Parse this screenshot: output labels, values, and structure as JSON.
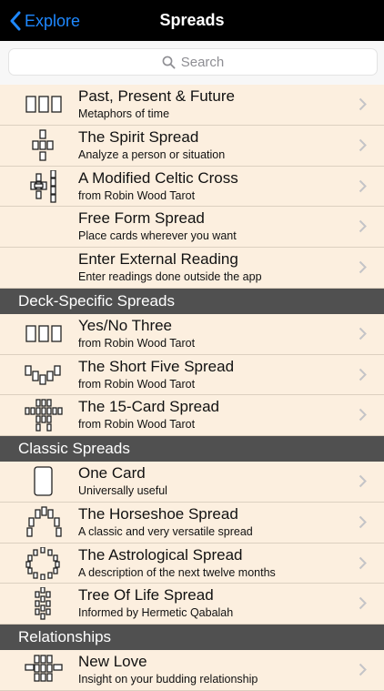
{
  "navbar": {
    "back_label": "Explore",
    "title": "Spreads"
  },
  "search": {
    "placeholder": "Search"
  },
  "section_top": [
    {
      "title": "Past, Present & Future",
      "subtitle": "Metaphors of time",
      "icon": "three-cards-icon"
    },
    {
      "title": "The Spirit Spread",
      "subtitle": "Analyze a person or situation",
      "icon": "spirit-spread-icon"
    },
    {
      "title": "A Modified Celtic Cross",
      "subtitle": "from Robin Wood Tarot",
      "icon": "celtic-cross-icon"
    },
    {
      "title": "Free Form Spread",
      "subtitle": "Place cards wherever you want",
      "icon": ""
    },
    {
      "title": "Enter External Reading",
      "subtitle": "Enter readings done outside the app",
      "icon": ""
    }
  ],
  "section_deck": {
    "header": "Deck-Specific Spreads",
    "items": [
      {
        "title": "Yes/No Three",
        "subtitle": "from Robin Wood Tarot",
        "icon": "three-cards-icon"
      },
      {
        "title": "The Short Five Spread",
        "subtitle": "from Robin Wood Tarot",
        "icon": "five-cards-icon"
      },
      {
        "title": "The 15-Card Spread",
        "subtitle": "from Robin Wood Tarot",
        "icon": "fifteen-cards-icon"
      }
    ]
  },
  "section_classic": {
    "header": "Classic Spreads",
    "items": [
      {
        "title": "One Card",
        "subtitle": "Universally useful",
        "icon": "one-card-icon"
      },
      {
        "title": "The Horseshoe Spread",
        "subtitle": "A classic and very versatile spread",
        "icon": "horseshoe-icon"
      },
      {
        "title": "The Astrological Spread",
        "subtitle": "A description of the next twelve months",
        "icon": "astrological-circle-icon"
      },
      {
        "title": "Tree Of Life Spread",
        "subtitle": "Informed by Hermetic Qabalah",
        "icon": "tree-of-life-icon"
      }
    ]
  },
  "section_relationships": {
    "header": "Relationships",
    "items": [
      {
        "title": "New Love",
        "subtitle": "Insight on your budding relationship",
        "icon": "new-love-icon"
      }
    ]
  },
  "colors": {
    "accent": "#1e88ff",
    "background": "#fcefdf",
    "header": "#505050"
  }
}
